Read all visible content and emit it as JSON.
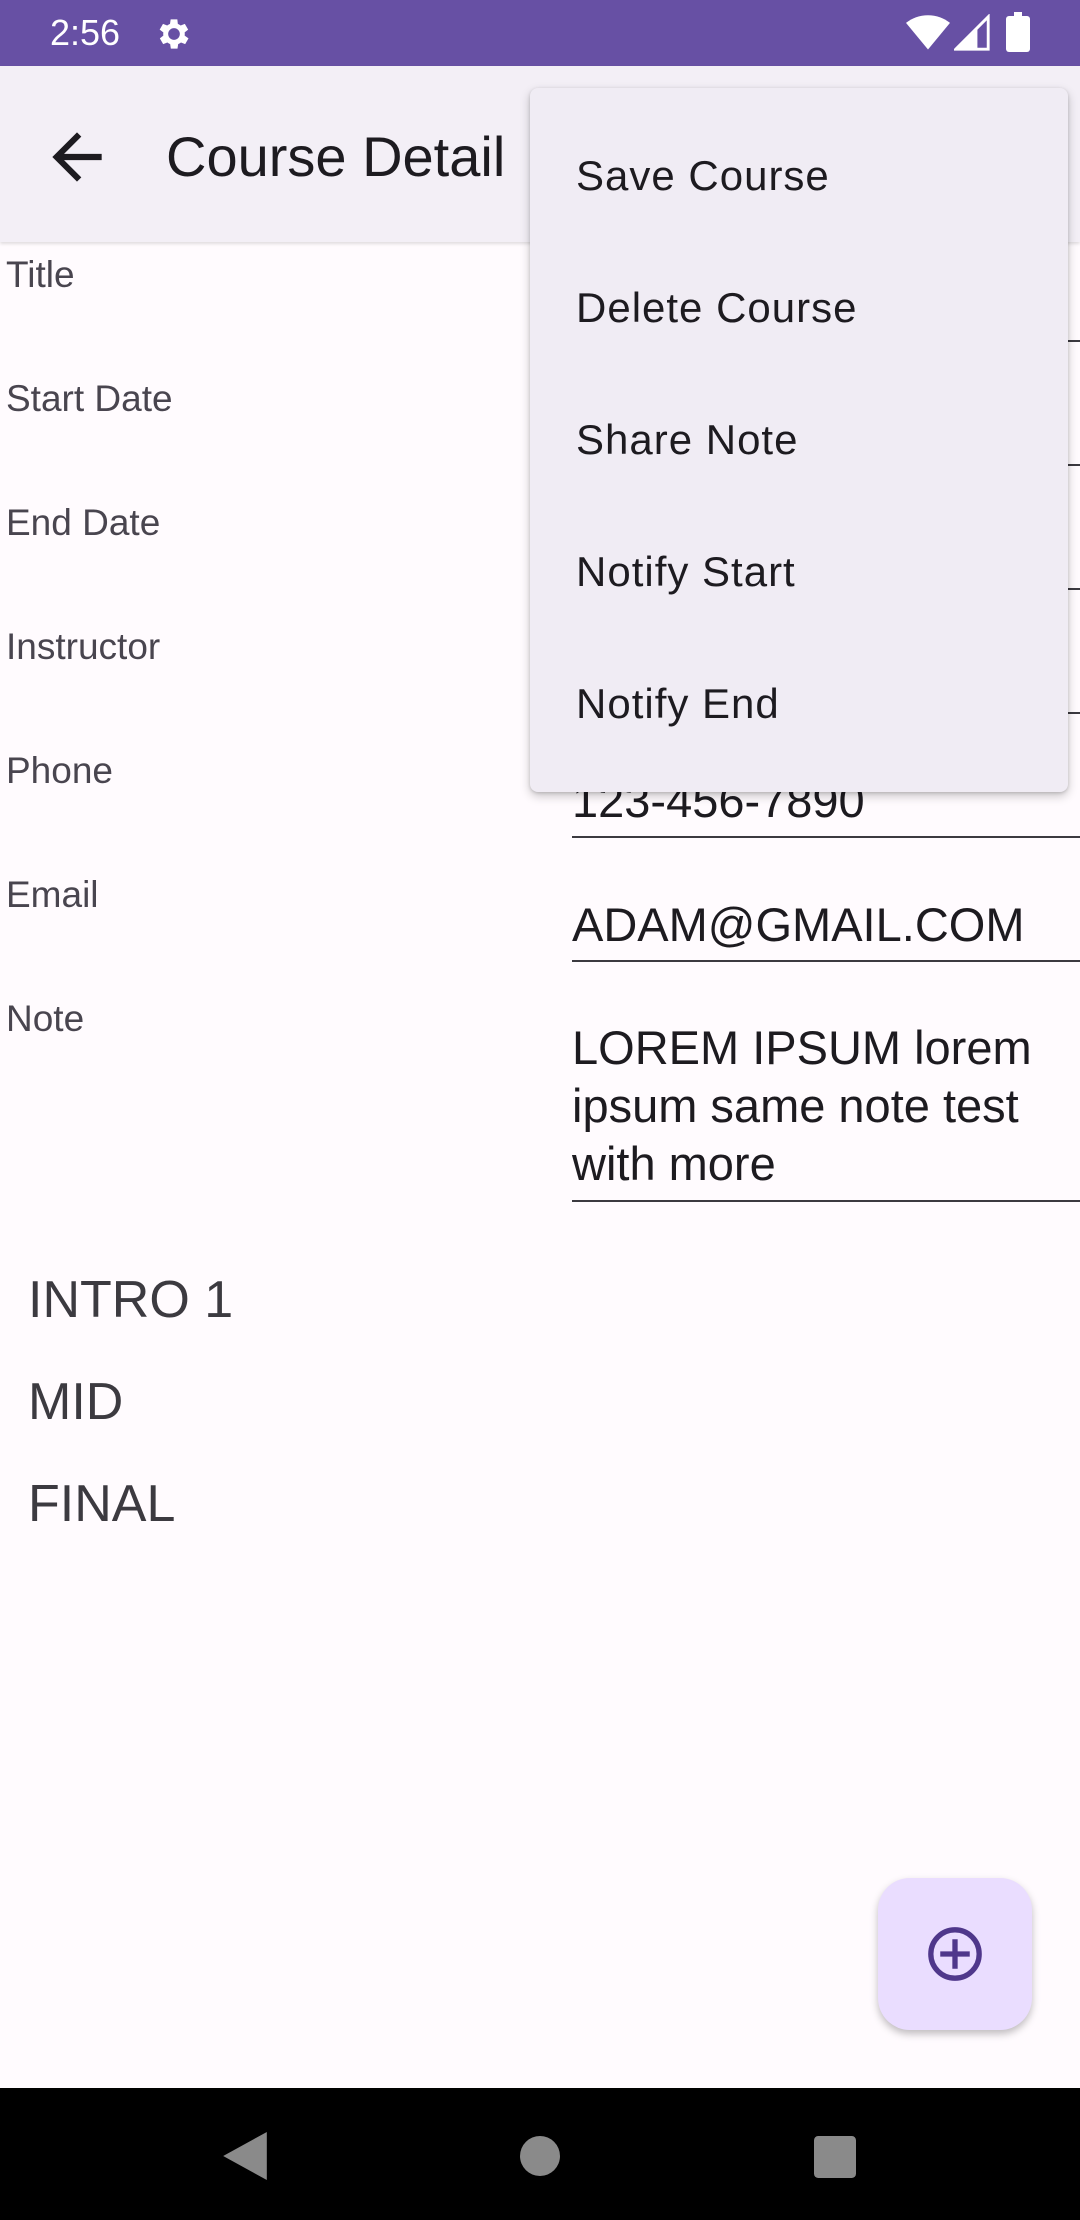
{
  "status_bar": {
    "time": "2:56",
    "icons": [
      "gear-icon",
      "wifi-icon",
      "signal-icon",
      "battery-icon"
    ],
    "background": "#6750a4"
  },
  "app_bar": {
    "title": "Course Detail",
    "back_icon": "arrow-back-icon"
  },
  "form": {
    "fields": [
      {
        "label": "Title",
        "value": ""
      },
      {
        "label": "Start Date",
        "value": ""
      },
      {
        "label": "End Date",
        "value": ""
      },
      {
        "label": "Instructor",
        "value": ""
      },
      {
        "label": "Phone",
        "value": "123-456-7890"
      },
      {
        "label": "Email",
        "value": "ADAM@GMAIL.COM"
      },
      {
        "label": "Note",
        "value": "LOREM IPSUM lorem ipsum same note test with more"
      }
    ]
  },
  "assessments": [
    "INTRO 1",
    "MID",
    "FINAL"
  ],
  "menu": {
    "items": [
      "Save Course",
      "Delete Course",
      "Share Note",
      "Notify Start",
      "Notify End"
    ],
    "background": "#f0ecf4"
  },
  "fab": {
    "icon": "add-circle-icon",
    "background": "#eaddff",
    "icon_color": "#4f378b"
  },
  "nav_bar": {
    "icons": [
      "nav-back-icon",
      "nav-home-icon",
      "nav-recents-icon"
    ]
  }
}
